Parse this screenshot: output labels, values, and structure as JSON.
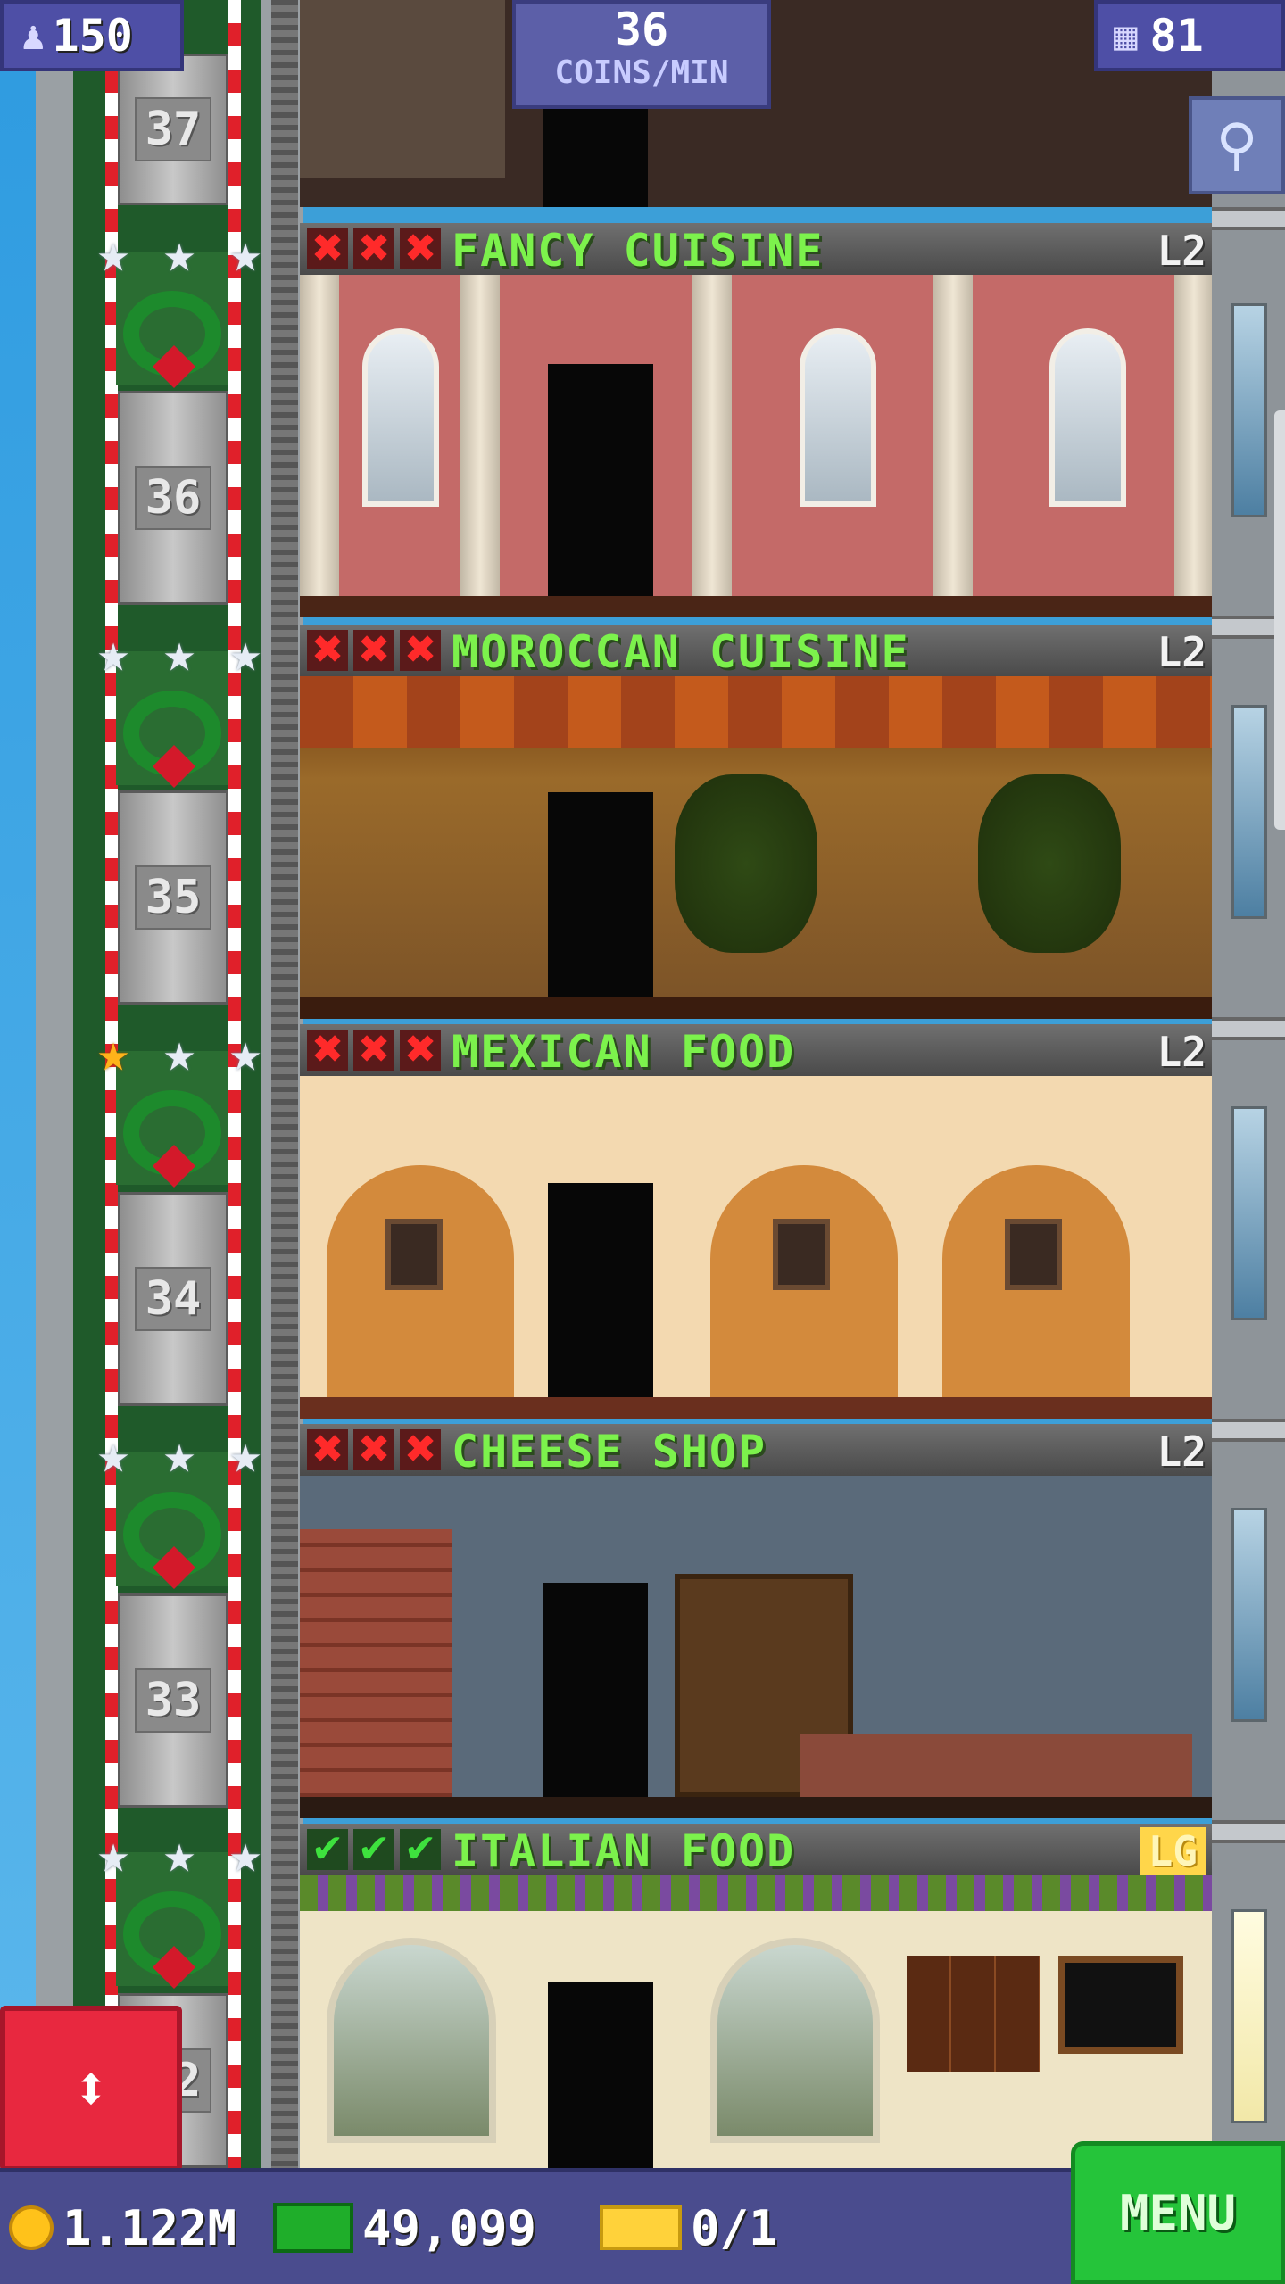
{
  "hud": {
    "population": "150",
    "coin_rate_value": "36",
    "coin_rate_unit": "COINS/MIN",
    "floors": "81",
    "population_icon": "person-icon",
    "floors_icon": "building-icon",
    "search_icon": "magnifier-icon"
  },
  "elevator": {
    "car_numbers": [
      "37",
      "36",
      "35",
      "34",
      "33",
      "32"
    ],
    "nav_icon": "up-down-arrows-icon"
  },
  "floors": [
    {
      "name": "FANCY CUISINE",
      "level": "L2",
      "stock": [
        "x",
        "x",
        "x"
      ],
      "stars": [
        "silver",
        "silver",
        "silver"
      ]
    },
    {
      "name": "MOROCCAN CUISINE",
      "level": "L2",
      "stock": [
        "x",
        "x",
        "x"
      ],
      "stars": [
        "silver",
        "silver",
        "silver"
      ]
    },
    {
      "name": "MEXICAN FOOD",
      "level": "L2",
      "stock": [
        "x",
        "x",
        "x"
      ],
      "stars": [
        "gold",
        "silver",
        "silver"
      ]
    },
    {
      "name": "CHEESE SHOP",
      "level": "L2",
      "stock": [
        "x",
        "x",
        "x"
      ],
      "stars": [
        "silver",
        "silver",
        "silver"
      ]
    },
    {
      "name": "ITALIAN FOOD",
      "level": "LG",
      "stock": [
        "check",
        "check",
        "check"
      ],
      "stars": [
        "silver",
        "silver",
        "silver"
      ]
    }
  ],
  "bottom_bar": {
    "coins": "1.122M",
    "bux": "49,099",
    "tickets": "0/1",
    "menu_label": "MENU"
  },
  "colors": {
    "hud_bg": "#4e4fa6",
    "floor_name": "#7cf24c",
    "menu_green": "#25c43a",
    "elevator_button_red": "#e8283f"
  }
}
